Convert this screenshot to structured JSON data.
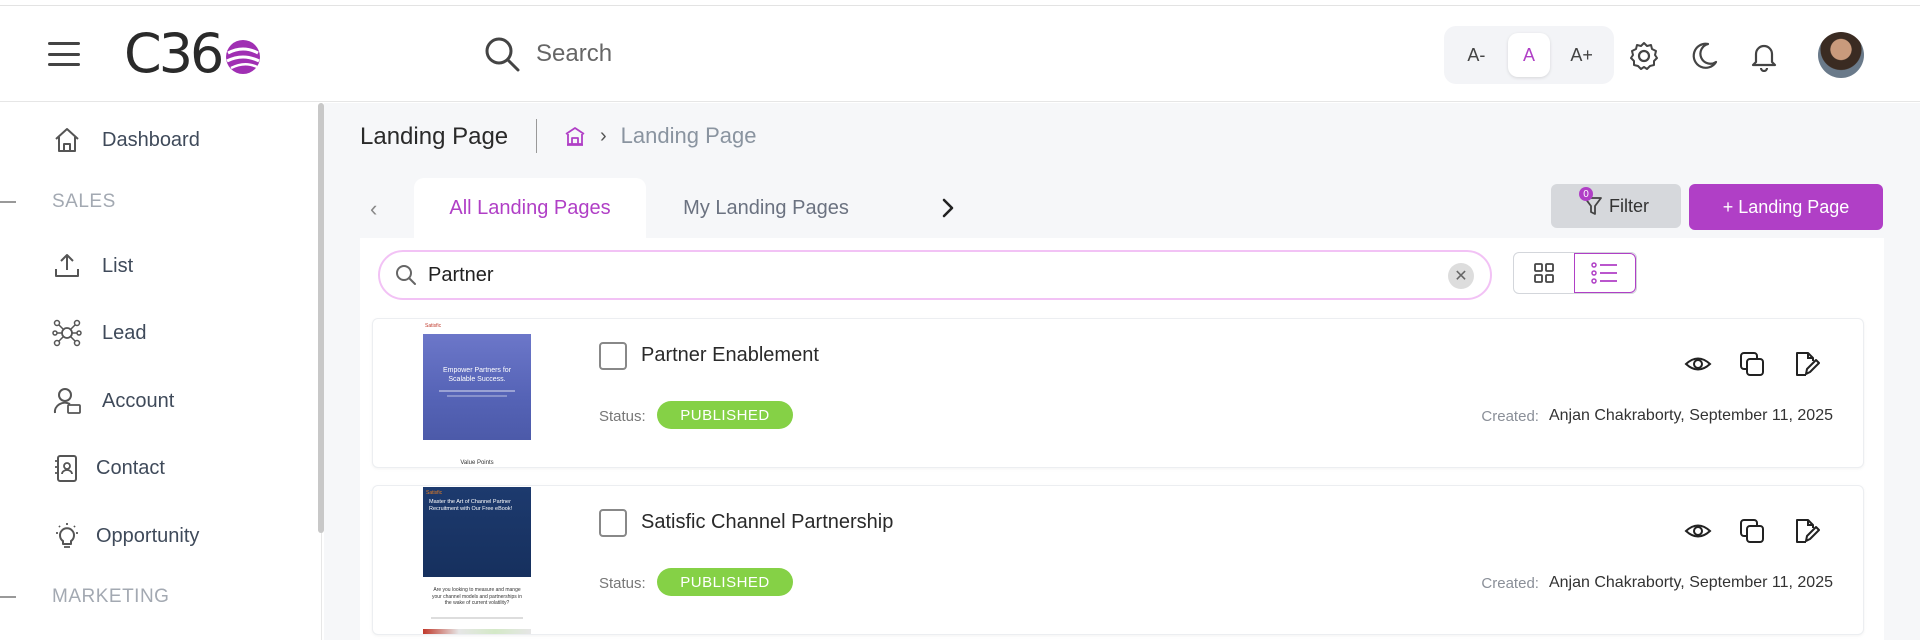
{
  "header": {
    "logo_text": "C36",
    "search_placeholder": "Search",
    "font_controls": [
      "A-",
      "A",
      "A+"
    ],
    "icons": [
      "settings-icon",
      "moon-icon",
      "bell-icon"
    ]
  },
  "sidebar": {
    "items": [
      {
        "label": "Dashboard",
        "icon": "home-icon"
      },
      {
        "section": "SALES"
      },
      {
        "label": "List",
        "icon": "upload-icon"
      },
      {
        "label": "Lead",
        "icon": "network-icon"
      },
      {
        "label": "Account",
        "icon": "user-icon"
      },
      {
        "label": "Contact",
        "icon": "contact-card-icon"
      },
      {
        "label": "Opportunity",
        "icon": "bulb-icon"
      },
      {
        "section": "MARKETING"
      }
    ]
  },
  "main": {
    "title": "Landing Page",
    "breadcrumb": "Landing Page",
    "tabs": [
      "All Landing Pages",
      "My Landing Pages"
    ],
    "filter_label": "Filter",
    "filter_count": "0",
    "add_label": "+ Landing Page",
    "list_search_value": "Partner",
    "records": [
      {
        "title": "Partner Enablement",
        "status_label": "Status:",
        "status": "PUBLISHED",
        "created_label": "Created:",
        "created": "Anjan Chakraborty, September 11, 2025",
        "thumb_brand": "Satisfic",
        "thumb_headline": "Empower Partners for Scalable Success.",
        "thumb_footer": "Value Points"
      },
      {
        "title": "Satisfic Channel Partnership",
        "status_label": "Status:",
        "status": "PUBLISHED",
        "created_label": "Created:",
        "created": "Anjan Chakraborty, September 11, 2025",
        "thumb_brand": "Satisfic",
        "thumb_headline": "Master the Art of Channel Partner Recruitment with Our Free eBook!",
        "thumb_footer": "Are you looking to measure and mange your channel models and partnerships in the wake of current volatility?"
      }
    ]
  },
  "colors": {
    "accent": "#b03fc6",
    "status_published": "#85d146"
  }
}
